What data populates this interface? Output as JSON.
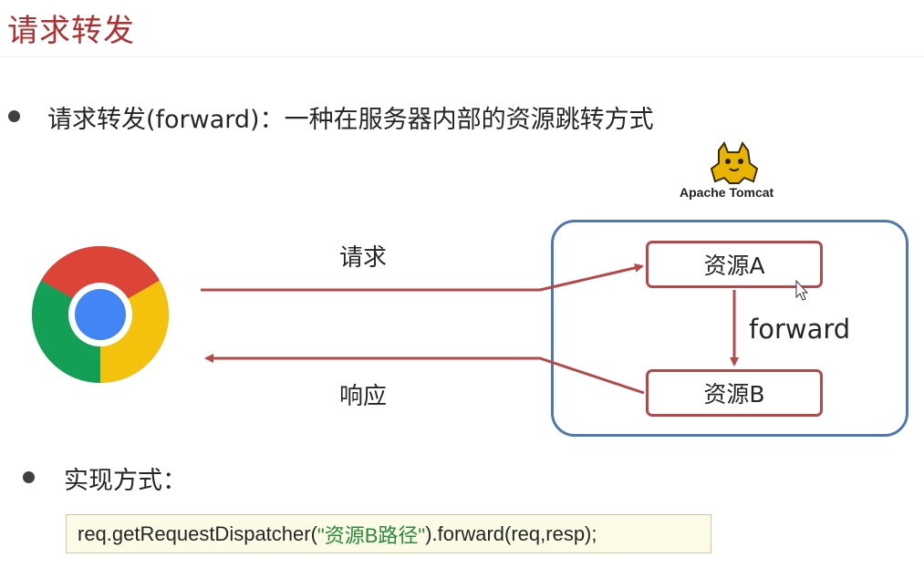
{
  "slide": {
    "title": "请求转发"
  },
  "bullets": [
    {
      "text": "请求转发(forward)：一种在服务器内部的资源跳转方式"
    },
    {
      "text": "实现方式："
    }
  ],
  "diagram": {
    "client_icon": "chrome-browser-icon",
    "server_logo_icon": "tomcat-cat-icon",
    "server_label": "Apache Tomcat",
    "request_label": "请求",
    "response_label": "响应",
    "resource_a": "资源A",
    "resource_b": "资源B",
    "forward_label": "forward",
    "colors": {
      "arrow": "#b54848",
      "container": "#4f78b0"
    }
  },
  "code": {
    "prefix": "req.getRequestDispatcher(",
    "string_arg": "\"资源B路径\"",
    "suffix": ").forward(req,resp);"
  }
}
